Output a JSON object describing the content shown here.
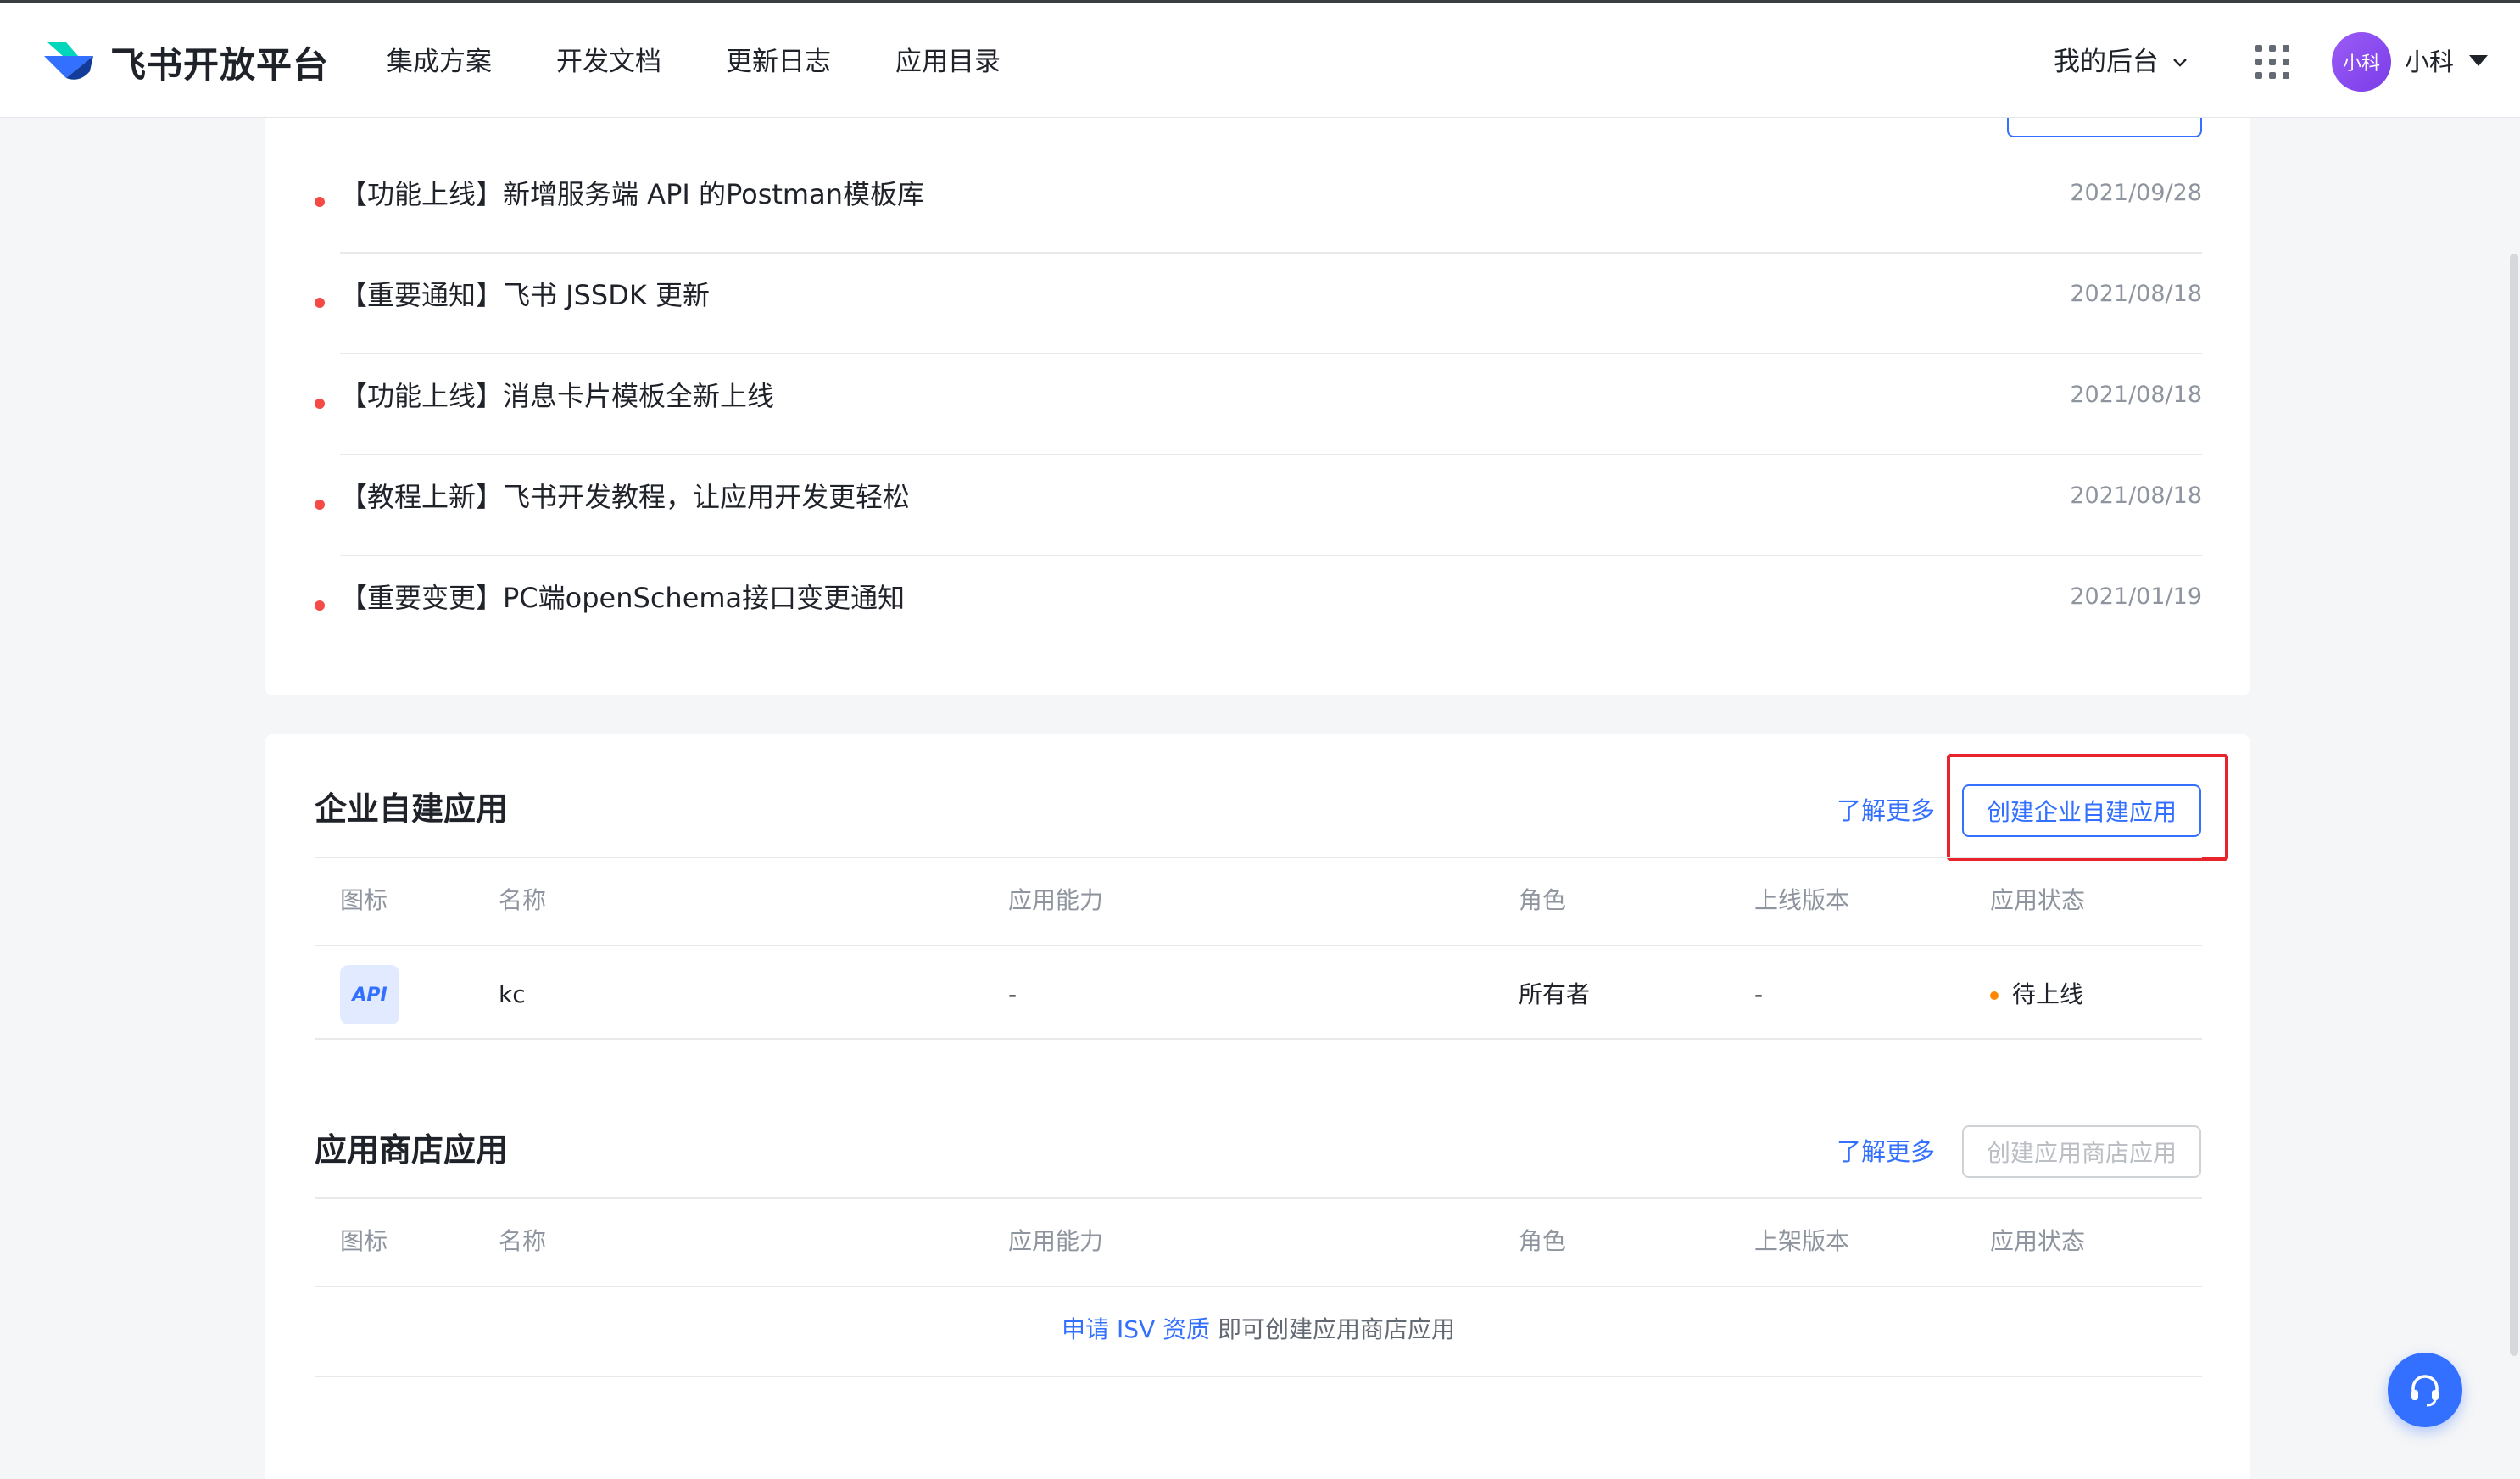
{
  "header": {
    "brand": "飞书开放平台",
    "nav": [
      "集成方案",
      "开发文档",
      "更新日志",
      "应用目录"
    ],
    "console_label": "我的后台",
    "avatar_text": "小科",
    "username": "小科"
  },
  "news": {
    "items": [
      {
        "title": "【功能上线】新增服务端 API 的Postman模板库",
        "date": "2021/09/28"
      },
      {
        "title": "【重要通知】飞书 JSSDK 更新",
        "date": "2021/08/18"
      },
      {
        "title": "【功能上线】消息卡片模板全新上线",
        "date": "2021/08/18"
      },
      {
        "title": "【教程上新】飞书开发教程，让应用开发更轻松",
        "date": "2021/08/18"
      },
      {
        "title": "【重要变更】PC端openSchema接口变更通知",
        "date": "2021/01/19"
      }
    ]
  },
  "custom_apps": {
    "title": "企业自建应用",
    "learn_more": "了解更多",
    "create_button": "创建企业自建应用",
    "columns": [
      "图标",
      "名称",
      "应用能力",
      "角色",
      "上线版本",
      "应用状态"
    ],
    "rows": [
      {
        "icon_text": "API",
        "name": "kc",
        "capability": "-",
        "role": "所有者",
        "version": "-",
        "status": "待上线"
      }
    ]
  },
  "store_apps": {
    "title": "应用商店应用",
    "learn_more": "了解更多",
    "create_button": "创建应用商店应用",
    "columns": [
      "图标",
      "名称",
      "应用能力",
      "角色",
      "上架版本",
      "应用状态"
    ],
    "empty_link": "申请 ISV 资质",
    "empty_text": " 即可创建应用商店应用"
  },
  "colors": {
    "accent": "#3370ff",
    "news_dot": "#f54a45",
    "status_pending": "#ff8800",
    "highlight": "#e8232b"
  }
}
